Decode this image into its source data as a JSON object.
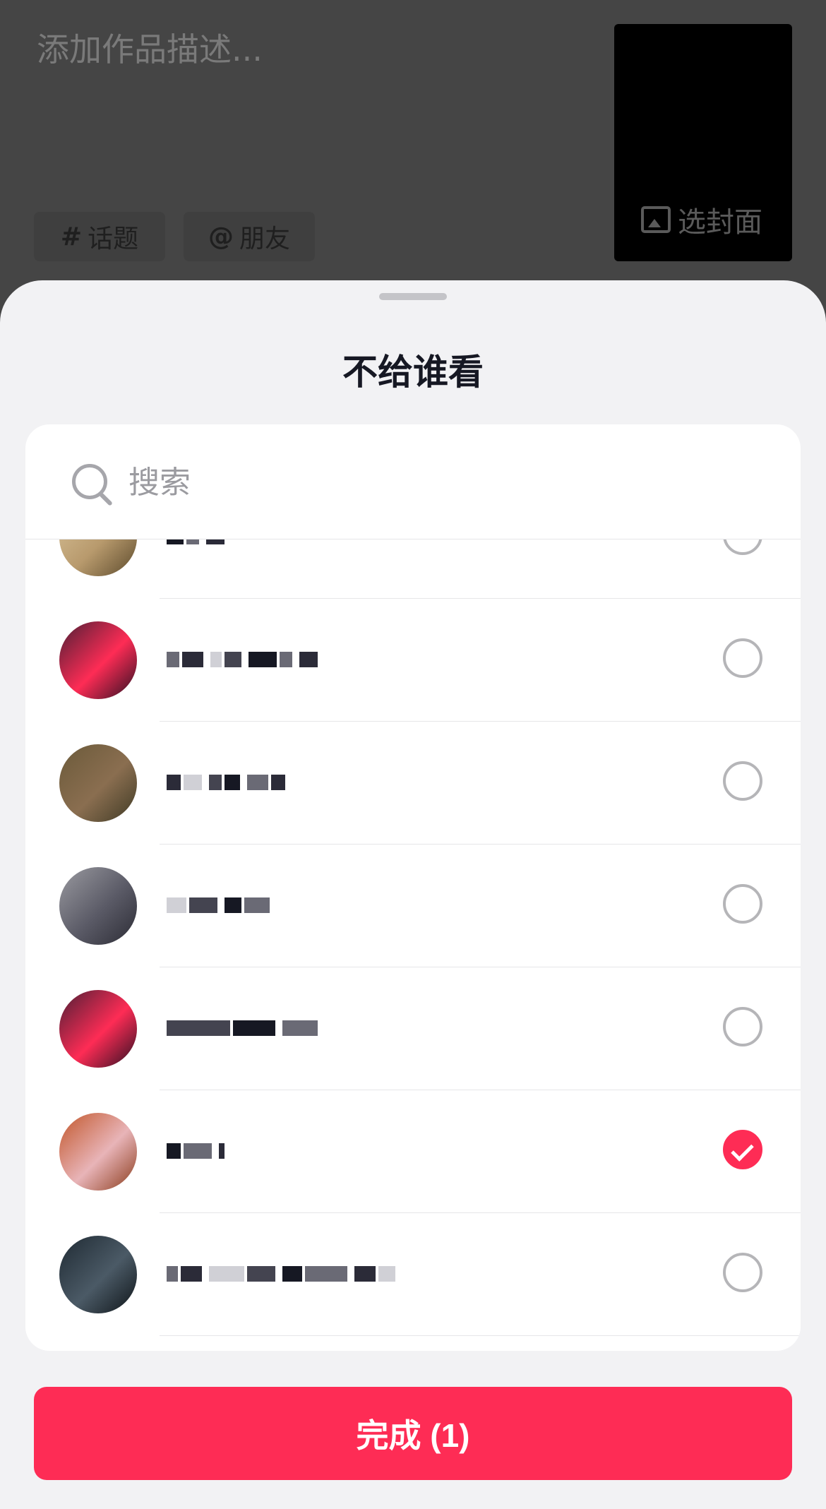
{
  "editor": {
    "description_placeholder": "添加作品描述...",
    "topic_chip": {
      "symbol": "#",
      "label": "话题"
    },
    "friend_chip": {
      "symbol": "@",
      "label": "朋友"
    },
    "cover_label": "选封面"
  },
  "sheet": {
    "title": "不给谁看",
    "search_placeholder": "搜索",
    "contacts": [
      {
        "selected": false,
        "avatar_colors": [
          "#d9c39a",
          "#b89a6d",
          "#5c4a2c"
        ]
      },
      {
        "selected": false,
        "avatar_colors": [
          "#4b1f35",
          "#fe2c55",
          "#2a1022"
        ]
      },
      {
        "selected": false,
        "avatar_colors": [
          "#6b5a3a",
          "#8a6e50",
          "#3f3a25"
        ]
      },
      {
        "selected": false,
        "avatar_colors": [
          "#9a9aa0",
          "#5a5a66",
          "#2c2c35"
        ]
      },
      {
        "selected": false,
        "avatar_colors": [
          "#4b1f35",
          "#fe2c55",
          "#2a1022"
        ]
      },
      {
        "selected": true,
        "avatar_colors": [
          "#c2562a",
          "#e8b4b8",
          "#8a3a1a"
        ]
      },
      {
        "selected": false,
        "avatar_colors": [
          "#1f2a33",
          "#4b5a66",
          "#0e1418"
        ]
      }
    ],
    "done_button": "完成 (1)"
  },
  "colors": {
    "accent": "#fe2c55",
    "sheet_bg": "#f2f2f4",
    "dim_bg": "#454545"
  }
}
